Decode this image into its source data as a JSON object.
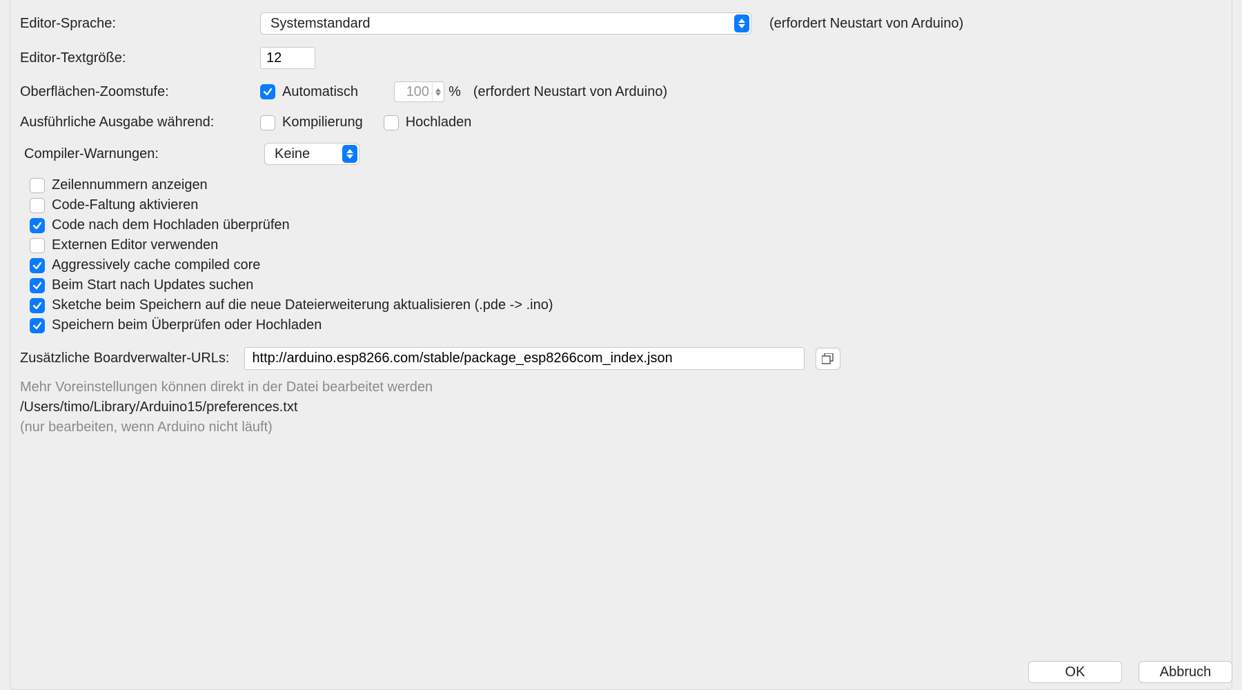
{
  "labels": {
    "editorLanguage": "Editor-Sprache:",
    "restartNote": "(erfordert Neustart von Arduino)",
    "editorTextSize": "Editor-Textgröße:",
    "zoomLevel": "Oberflächen-Zoomstufe:",
    "auto": "Automatisch",
    "percent": "%",
    "verboseOutput": "Ausführliche Ausgabe während:",
    "compile": "Kompilierung",
    "upload": "Hochladen",
    "compilerWarn": "Compiler-Warnungen:",
    "boardUrls": "Zusätzliche Boardverwalter-URLs:"
  },
  "values": {
    "language": "Systemstandard",
    "textSize": "12",
    "zoom": "100",
    "compilerWarn": "Keine",
    "boardUrl": "http://arduino.esp8266.com/stable/package_esp8266com_index.json"
  },
  "options": [
    {
      "checked": false,
      "label": "Zeilennummern anzeigen"
    },
    {
      "checked": false,
      "label": "Code-Faltung aktivieren"
    },
    {
      "checked": true,
      "label": "Code nach dem Hochladen überprüfen"
    },
    {
      "checked": false,
      "label": "Externen Editor verwenden"
    },
    {
      "checked": true,
      "label": "Aggressively cache compiled core"
    },
    {
      "checked": true,
      "label": "Beim Start nach Updates suchen"
    },
    {
      "checked": true,
      "label": "Sketche beim Speichern auf die neue Dateierweiterung aktualisieren (.pde -> .ino)"
    },
    {
      "checked": true,
      "label": "Speichern beim Überprüfen oder Hochladen"
    }
  ],
  "checks": {
    "autoZoom": true,
    "compile": false,
    "upload": false
  },
  "foot": {
    "line1": "Mehr Voreinstellungen können direkt in der Datei bearbeitet werden",
    "path": "/Users/timo/Library/Arduino15/preferences.txt",
    "line2": "(nur bearbeiten, wenn Arduino nicht läuft)"
  },
  "buttons": {
    "ok": "OK",
    "cancel": "Abbruch"
  }
}
